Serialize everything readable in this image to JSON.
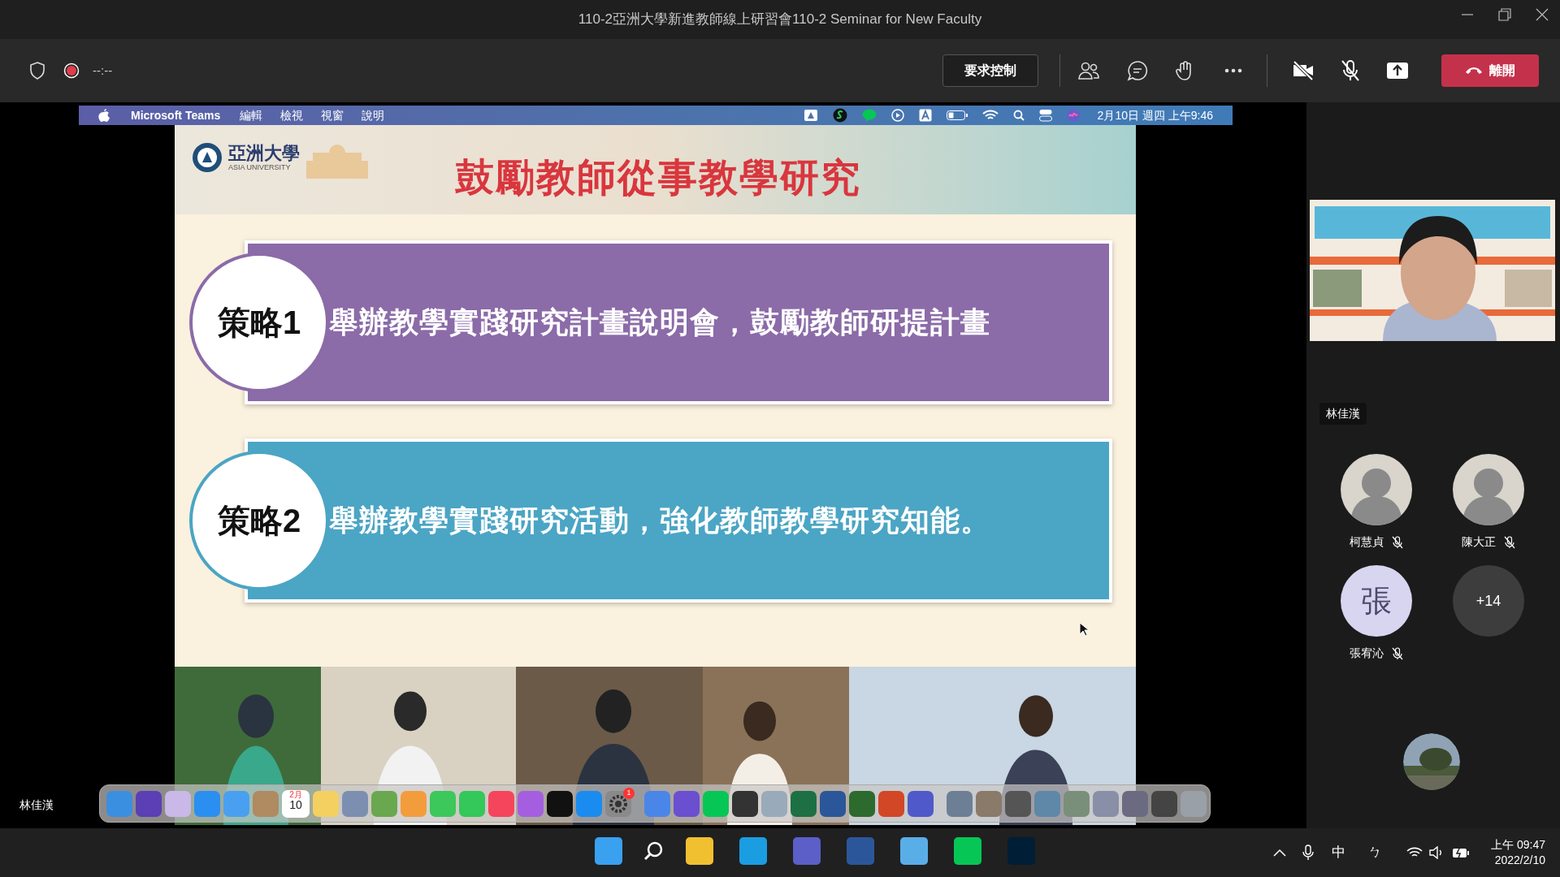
{
  "window": {
    "title": "110-2亞洲大學新進教師線上研習會110-2 Seminar for New Faculty"
  },
  "toolbar": {
    "timer": "--:--",
    "request_control": "要求控制",
    "leave": "離開",
    "recording": true
  },
  "shared_screen": {
    "menubar": {
      "app": "Microsoft Teams",
      "menus": [
        "編輯",
        "檢視",
        "視窗",
        "說明"
      ],
      "clock": "2月10日 週四 上午9:46"
    },
    "slide": {
      "logo_name": "亞洲大學",
      "logo_sub": "ASIA UNIVERSITY",
      "title": "鼓勵教師從事教學研究",
      "strategies": [
        {
          "label": "策略1",
          "text": "舉辦教學實踐研究計畫說明會，鼓勵教師研提計畫",
          "color": "#8b6ba8"
        },
        {
          "label": "策略2",
          "text": "舉辦教學實踐研究活動，強化教師教學研究知能。",
          "color": "#4ba5c4"
        }
      ]
    },
    "dock": {
      "calendar_month": "2月",
      "calendar_day": "10",
      "badge": "1"
    }
  },
  "stage_label": "林佳漢",
  "roster": {
    "spotlight_name": "林佳漢",
    "participants": [
      {
        "name": "柯慧貞",
        "muted": true
      },
      {
        "name": "陳大正",
        "muted": true
      },
      {
        "kind": "initial",
        "initial": "張",
        "name": "張宥沁",
        "muted": true
      },
      {
        "kind": "overflow",
        "count": "+14"
      }
    ]
  },
  "taskbar": {
    "ime_language": "中",
    "ime_mode": "ㄅ",
    "time": "上午 09:47",
    "date": "2022/2/10"
  }
}
